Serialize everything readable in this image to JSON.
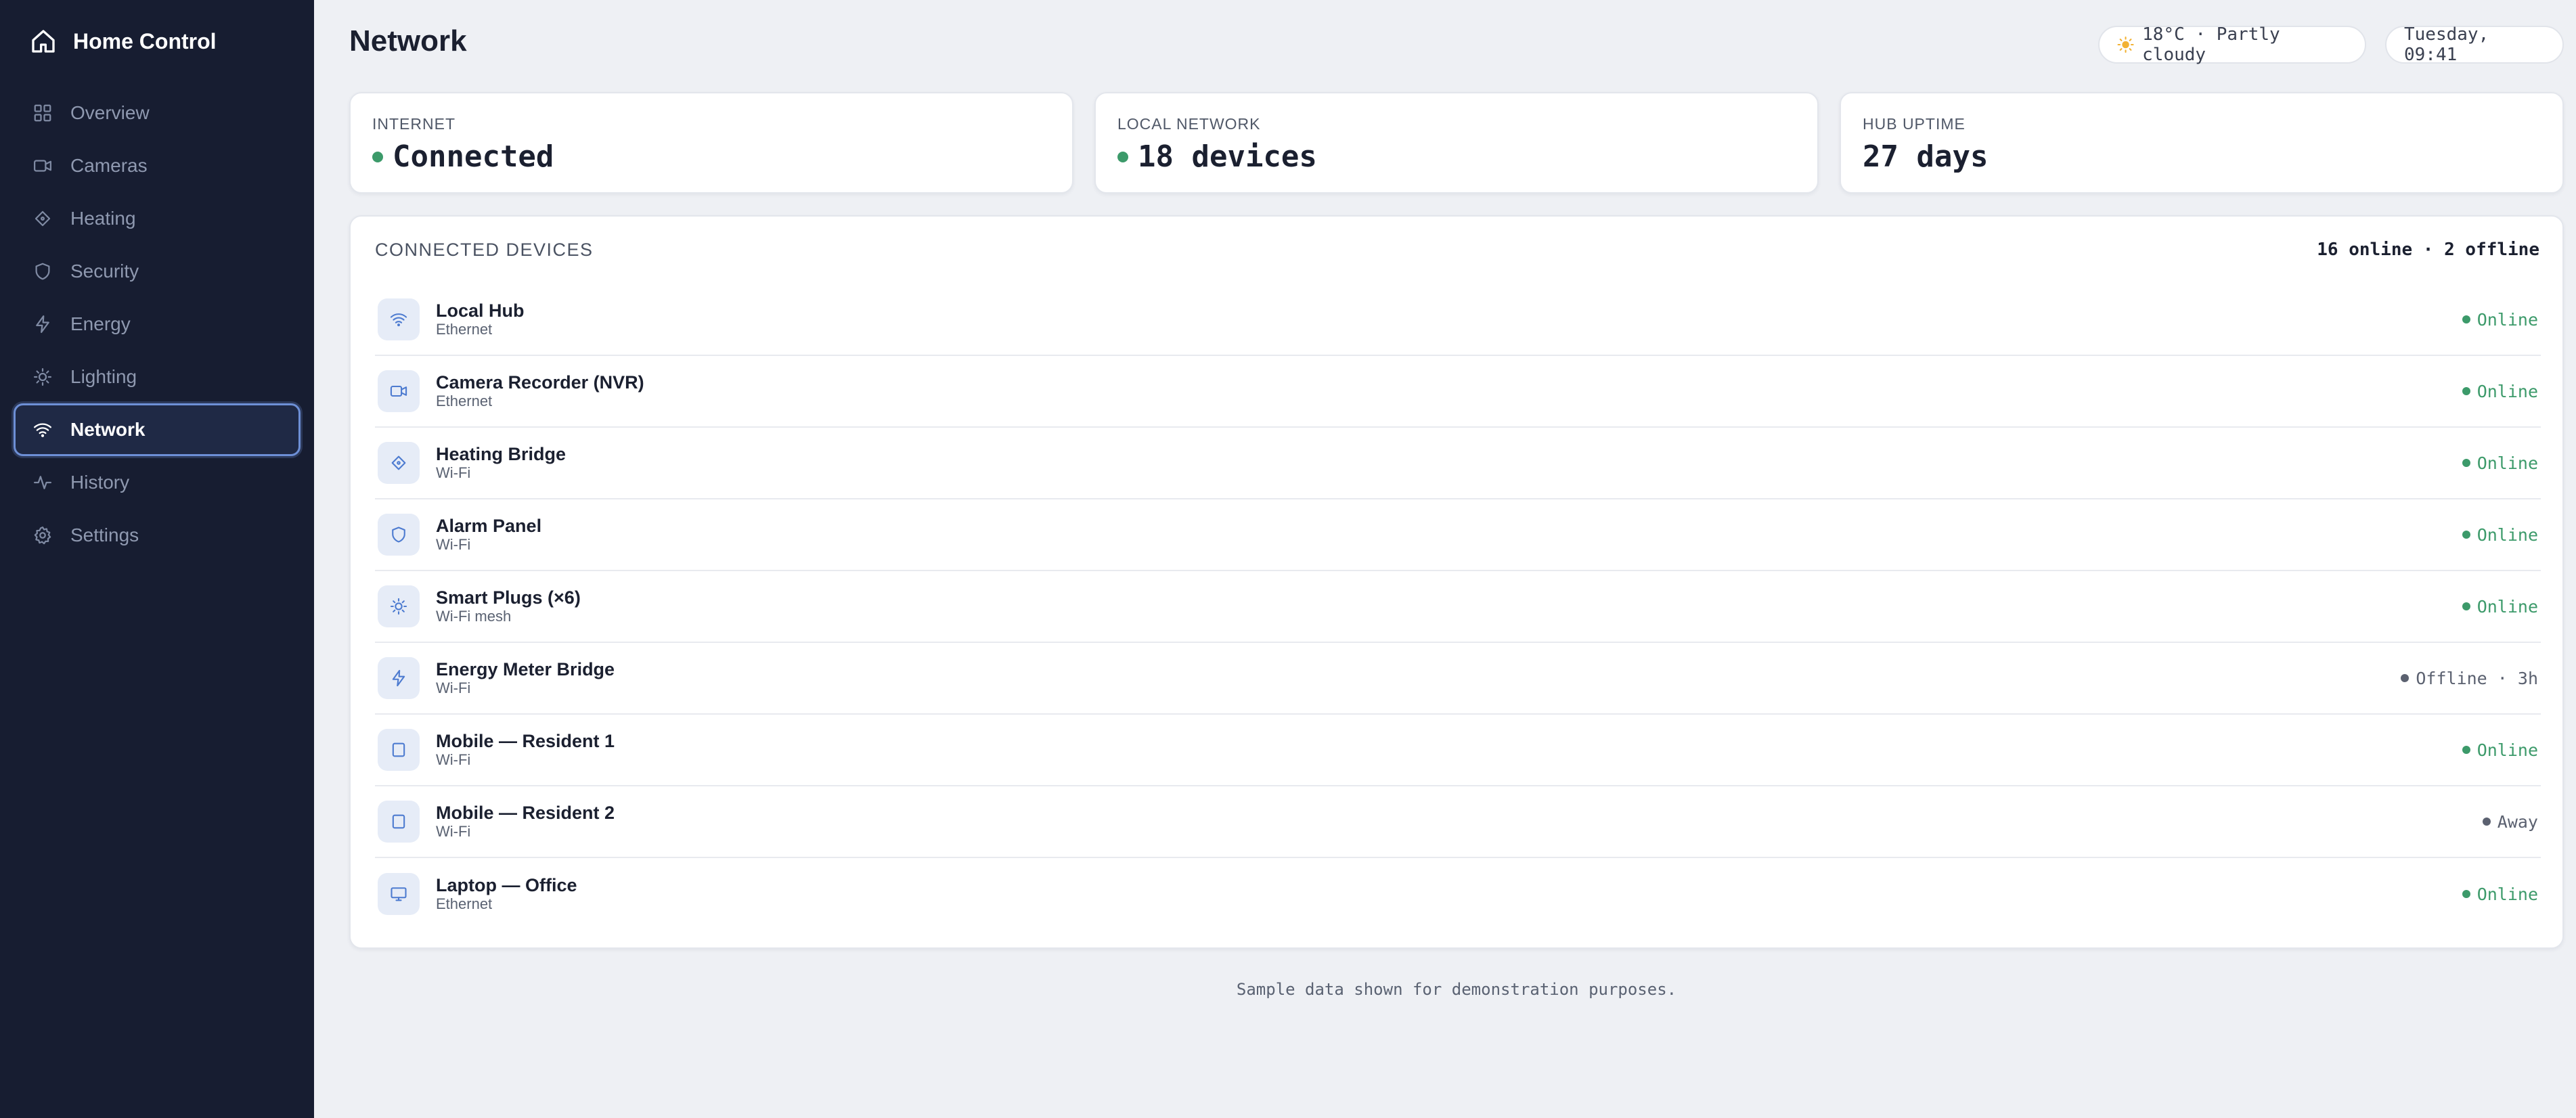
{
  "app": {
    "title": "Home Control"
  },
  "sidebar": {
    "items": [
      {
        "label": "Overview",
        "icon": "grid-icon",
        "active": false
      },
      {
        "label": "Cameras",
        "icon": "camera-icon",
        "active": false
      },
      {
        "label": "Heating",
        "icon": "diamond-icon",
        "active": false
      },
      {
        "label": "Security",
        "icon": "shield-icon",
        "active": false
      },
      {
        "label": "Energy",
        "icon": "bolt-icon",
        "active": false
      },
      {
        "label": "Lighting",
        "icon": "sun-icon",
        "active": false
      },
      {
        "label": "Network",
        "icon": "wifi-icon",
        "active": true
      },
      {
        "label": "History",
        "icon": "pulse-icon",
        "active": false
      },
      {
        "label": "Settings",
        "icon": "gear-icon",
        "active": false
      }
    ]
  },
  "header": {
    "title": "Network",
    "weather": "18°C · Partly cloudy",
    "datetime": "Tuesday, 09:41"
  },
  "stats": [
    {
      "label": "INTERNET",
      "value": "Connected",
      "indicator": true
    },
    {
      "label": "LOCAL NETWORK",
      "value": "18 devices",
      "indicator": true
    },
    {
      "label": "HUB UPTIME",
      "value": "27 days",
      "indicator": false
    }
  ],
  "devices": {
    "title": "CONNECTED DEVICES",
    "summary": "16 online · 2 offline",
    "rows": [
      {
        "name": "Local Hub",
        "connection": "Ethernet",
        "icon": "wifi-icon",
        "status": "Online",
        "state": "online"
      },
      {
        "name": "Camera Recorder (NVR)",
        "connection": "Ethernet",
        "icon": "camera-icon",
        "status": "Online",
        "state": "online"
      },
      {
        "name": "Heating Bridge",
        "connection": "Wi-Fi",
        "icon": "diamond-icon",
        "status": "Online",
        "state": "online"
      },
      {
        "name": "Alarm Panel",
        "connection": "Wi-Fi",
        "icon": "shield-icon",
        "status": "Online",
        "state": "online"
      },
      {
        "name": "Smart Plugs (×6)",
        "connection": "Wi-Fi mesh",
        "icon": "sun-icon",
        "status": "Online",
        "state": "online"
      },
      {
        "name": "Energy Meter Bridge",
        "connection": "Wi-Fi",
        "icon": "bolt-icon",
        "status": "Offline · 3h",
        "state": "offline"
      },
      {
        "name": "Mobile — Resident 1",
        "connection": "Wi-Fi",
        "icon": "phone-icon",
        "status": "Online",
        "state": "online"
      },
      {
        "name": "Mobile — Resident 2",
        "connection": "Wi-Fi",
        "icon": "phone-icon",
        "status": "Away",
        "state": "offline"
      },
      {
        "name": "Laptop — Office",
        "connection": "Ethernet",
        "icon": "monitor-icon",
        "status": "Online",
        "state": "online"
      }
    ]
  },
  "footnote": "Sample data shown for demonstration purposes.",
  "colors": {
    "sidebar": "#171d31",
    "accent": "#6d8fd6",
    "online": "#3c9a6a",
    "offline": "#5b6170",
    "background": "#eef0f4"
  }
}
